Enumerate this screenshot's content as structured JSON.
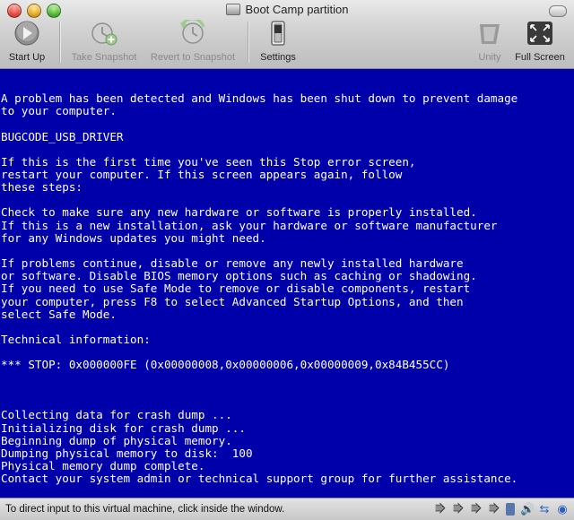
{
  "window": {
    "title": "Boot Camp partition"
  },
  "toolbar": {
    "start_up": "Start Up",
    "take_snapshot": "Take Snapshot",
    "revert_to_snapshot": "Revert to Snapshot",
    "settings": "Settings",
    "unity": "Unity",
    "full_screen": "Full Screen"
  },
  "screen": {
    "paragraphs": [
      "A problem has been detected and Windows has been shut down to prevent damage\nto your computer.",
      "BUGCODE_USB_DRIVER",
      "If this is the first time you've seen this Stop error screen,\nrestart your computer. If this screen appears again, follow\nthese steps:",
      "Check to make sure any new hardware or software is properly installed.\nIf this is a new installation, ask your hardware or software manufacturer\nfor any Windows updates you might need.",
      "If problems continue, disable or remove any newly installed hardware\nor software. Disable BIOS memory options such as caching or shadowing.\nIf you need to use Safe Mode to remove or disable components, restart\nyour computer, press F8 to select Advanced Startup Options, and then\nselect Safe Mode.",
      "Technical information:",
      "*** STOP: 0x000000FE (0x00000008,0x00000006,0x00000009,0x84B455CC)",
      "Collecting data for crash dump ...\nInitializing disk for crash dump ...\nBeginning dump of physical memory.\nDumping physical memory to disk:  100\nPhysical memory dump complete.\nContact your system admin or technical support group for further assistance."
    ]
  },
  "statusbar": {
    "text": "To direct input to this virtual machine, click inside the window.",
    "icons": [
      "usb-icon",
      "usb-icon",
      "usb-icon",
      "usb-icon",
      "hard-disk-icon",
      "sound-icon",
      "network-icon",
      "cd-icon"
    ]
  },
  "colors": {
    "bsod_background": "#0000AA",
    "bsod_text": "#FFFFFF"
  }
}
